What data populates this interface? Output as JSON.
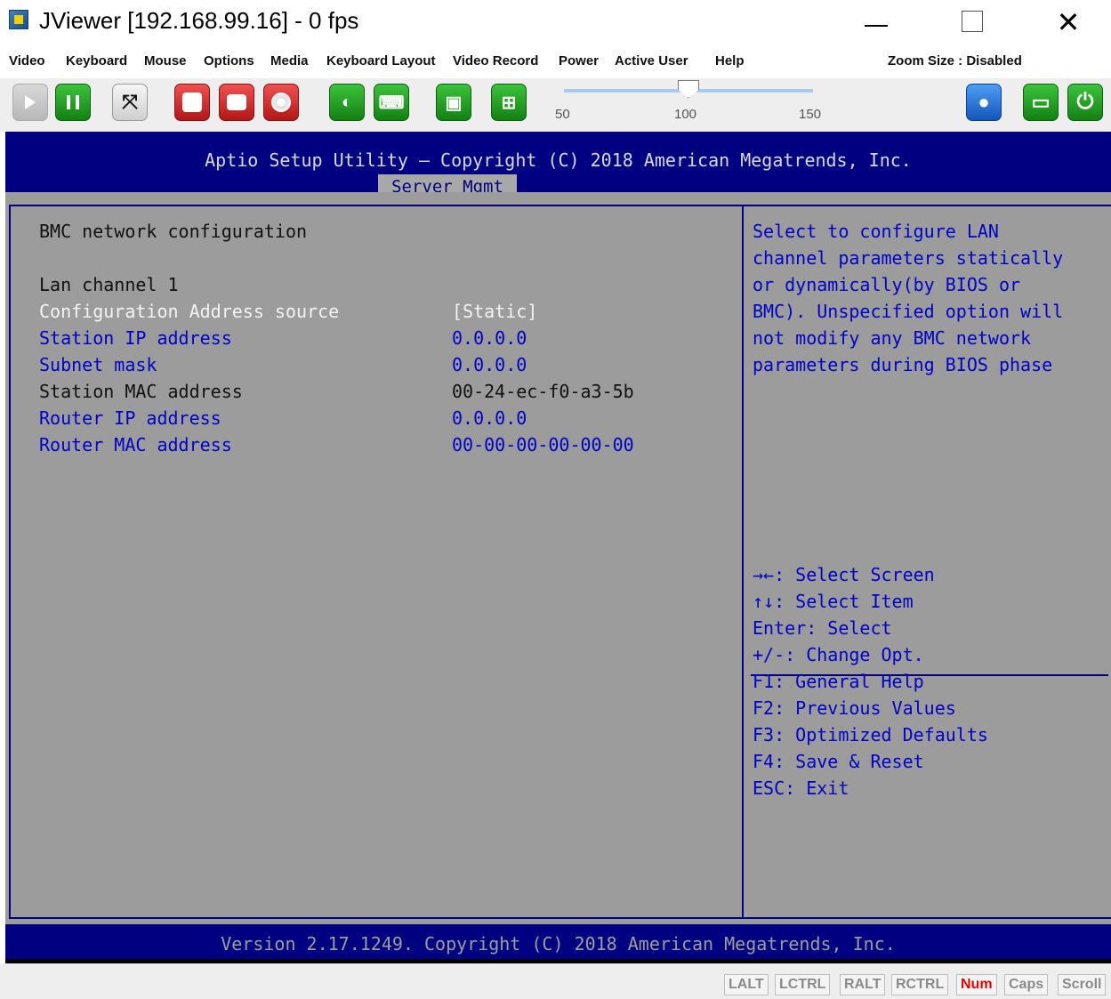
{
  "window": {
    "title": "JViewer [192.168.99.16] - 0 fps",
    "close_glyph": "✕"
  },
  "menu": {
    "items": [
      "Video",
      "Keyboard",
      "Mouse",
      "Options",
      "Media",
      "Keyboard Layout",
      "Video Record",
      "Power",
      "Active User",
      "Help"
    ],
    "zoom_label": "Zoom Size : Disabled"
  },
  "toolbar": {
    "slider": {
      "value": 100,
      "min": 50,
      "max": 150,
      "ticks": [
        "50",
        "100",
        "150"
      ]
    },
    "colors": {
      "green": "#1e9b1e",
      "red": "#d02020",
      "blue": "#2f7ee0",
      "silver": "#dcdcdc"
    }
  },
  "bios": {
    "heading": "Aptio Setup Utility – Copyright (C) 2018 American Megatrends, Inc.",
    "active_tab": "Server Mgmt",
    "section_title": "BMC network configuration",
    "channel_label": "Lan channel 1",
    "settings": [
      {
        "label": "Configuration Address source",
        "value": "[Static]",
        "selected": true
      },
      {
        "label": "Station IP address",
        "value": "0.0.0.0",
        "selected": false
      },
      {
        "label": "Subnet mask",
        "value": "0.0.0.0",
        "selected": false
      },
      {
        "label": "Station MAC address",
        "value": "00-24-ec-f0-a3-5b",
        "readonly": true
      },
      {
        "label": "Router IP address",
        "value": "0.0.0.0",
        "selected": false
      },
      {
        "label": "Router MAC address",
        "value": "00-00-00-00-00-00",
        "selected": false
      }
    ],
    "help_lines": [
      "Select to configure LAN",
      "channel parameters statically",
      "or dynamically(by BIOS or",
      "BMC). Unspecified option will",
      "not modify any BMC network",
      "parameters during BIOS phase"
    ],
    "key_help": [
      "→←: Select Screen",
      "↑↓: Select Item",
      "Enter: Select",
      "+/-: Change Opt.",
      "F1: General Help",
      "F2: Previous Values",
      "F3: Optimized Defaults",
      "F4: Save & Reset",
      "ESC: Exit"
    ],
    "footer": "Version 2.17.1249. Copyright (C) 2018 American Megatrends, Inc.",
    "colors": {
      "background": "#000080",
      "panel": "#9c9c9c",
      "text_blue": "#0000c8"
    }
  },
  "status": {
    "keys": [
      "LALT",
      "LCTRL",
      "RALT",
      "RCTRL",
      "Num",
      "Caps",
      "Scroll"
    ],
    "active_key": "Num"
  }
}
